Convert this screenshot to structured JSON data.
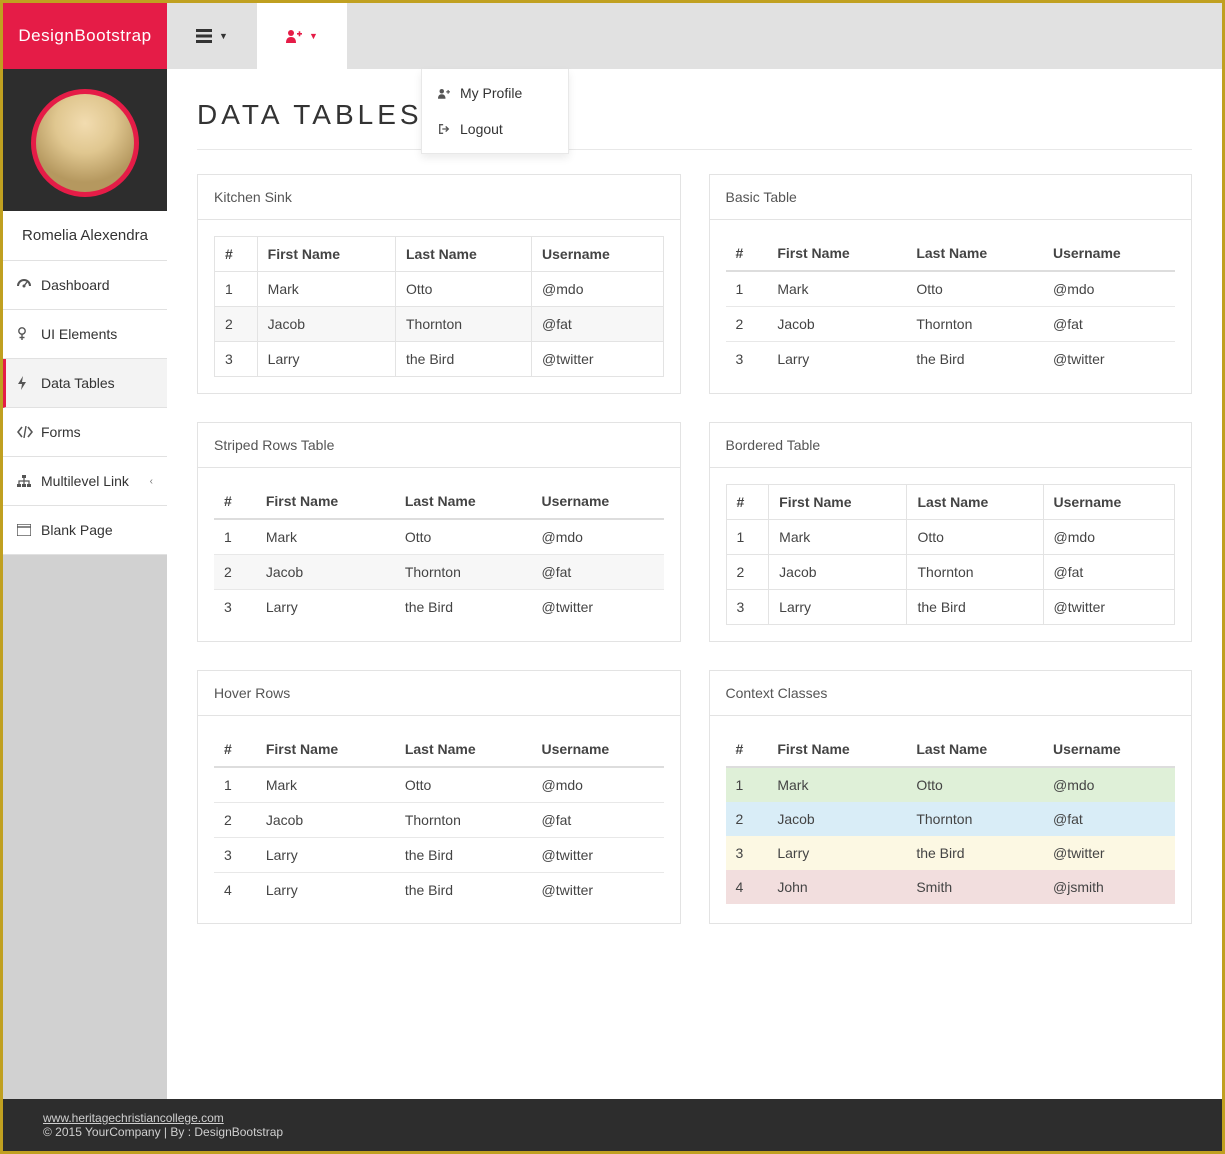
{
  "brand": "DesignBootstrap",
  "user": {
    "name": "Romelia Alexendra"
  },
  "nav": [
    {
      "icon": "dashboard",
      "label": "Dashboard"
    },
    {
      "icon": "female",
      "label": "UI Elements"
    },
    {
      "icon": "bolt",
      "label": "Data Tables",
      "active": true
    },
    {
      "icon": "code",
      "label": "Forms"
    },
    {
      "icon": "sitemap",
      "label": "Multilevel Link",
      "chevron": true
    },
    {
      "icon": "window",
      "label": "Blank Page"
    }
  ],
  "dropdown": {
    "profile": "My Profile",
    "logout": "Logout"
  },
  "page_title": "DATA TABLES",
  "table_headers": [
    "#",
    "First Name",
    "Last Name",
    "Username"
  ],
  "sample_rows_3": [
    [
      "1",
      "Mark",
      "Otto",
      "@mdo"
    ],
    [
      "2",
      "Jacob",
      "Thornton",
      "@fat"
    ],
    [
      "3",
      "Larry",
      "the Bird",
      "@twitter"
    ]
  ],
  "sample_rows_4": [
    [
      "1",
      "Mark",
      "Otto",
      "@mdo"
    ],
    [
      "2",
      "Jacob",
      "Thornton",
      "@fat"
    ],
    [
      "3",
      "Larry",
      "the Bird",
      "@twitter"
    ],
    [
      "4",
      "Larry",
      "the Bird",
      "@twitter"
    ]
  ],
  "context_rows": [
    {
      "cls": "ctx-success",
      "cells": [
        "1",
        "Mark",
        "Otto",
        "@mdo"
      ]
    },
    {
      "cls": "ctx-info",
      "cells": [
        "2",
        "Jacob",
        "Thornton",
        "@fat"
      ]
    },
    {
      "cls": "ctx-warning",
      "cells": [
        "3",
        "Larry",
        "the Bird",
        "@twitter"
      ]
    },
    {
      "cls": "ctx-danger",
      "cells": [
        "4",
        "John",
        "Smith",
        "@jsmith"
      ]
    }
  ],
  "panels": {
    "kitchen": "Kitchen Sink",
    "basic": "Basic Table",
    "striped": "Striped Rows Table",
    "bordered": "Bordered Table",
    "hover": "Hover Rows",
    "context": "Context Classes"
  },
  "footer": {
    "link": "www.heritagechristiancollege.com",
    "text": "© 2015 YourCompany | By : DesignBootstrap"
  }
}
